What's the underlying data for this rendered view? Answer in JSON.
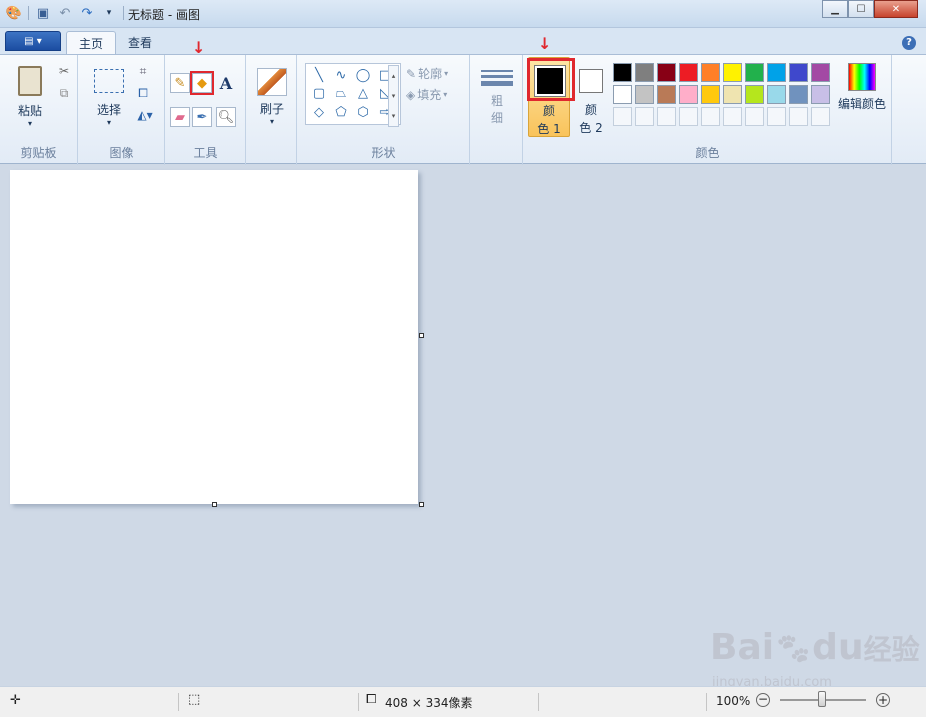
{
  "window": {
    "title": "无标题 - 画图"
  },
  "tabs": [
    {
      "label": "主页"
    },
    {
      "label": "查看"
    }
  ],
  "ribbon": {
    "clipboard": {
      "paste": "粘贴",
      "group": "剪贴板"
    },
    "image": {
      "select": "选择",
      "group": "图像"
    },
    "tools": {
      "group": "工具"
    },
    "brushes": {
      "label": "刷子"
    },
    "shapes": {
      "outline": "轮廓",
      "fill": "填充",
      "group": "形状"
    },
    "size": {
      "label_top": "粗",
      "label_bottom": "细"
    },
    "colors": {
      "color1_top": "颜",
      "color1_bottom": "色 1",
      "color2_top": "颜",
      "color2_bottom": "色 2",
      "edit": "编辑颜色",
      "group": "颜色",
      "palette_row1": [
        "#000000",
        "#7f7f7f",
        "#880015",
        "#ed1c24",
        "#ff7f27",
        "#fff200",
        "#22b14c",
        "#00a2e8",
        "#3f48cc",
        "#a349a4"
      ],
      "palette_row2": [
        "#ffffff",
        "#c3c3c3",
        "#b97a57",
        "#ffaec9",
        "#ffc90e",
        "#efe4b0",
        "#b5e61d",
        "#99d9ea",
        "#7092be",
        "#c8bfe7"
      ],
      "color1": "#000000",
      "color2": "#ffffff",
      "accent": "#e0282e"
    }
  },
  "status": {
    "canvas_size": "408 × 334像素",
    "zoom": "100%"
  },
  "watermark": {
    "brand": "Bai",
    "brand2": "du",
    "brand_cn": "经验",
    "url": "jingyan.baidu.com"
  }
}
